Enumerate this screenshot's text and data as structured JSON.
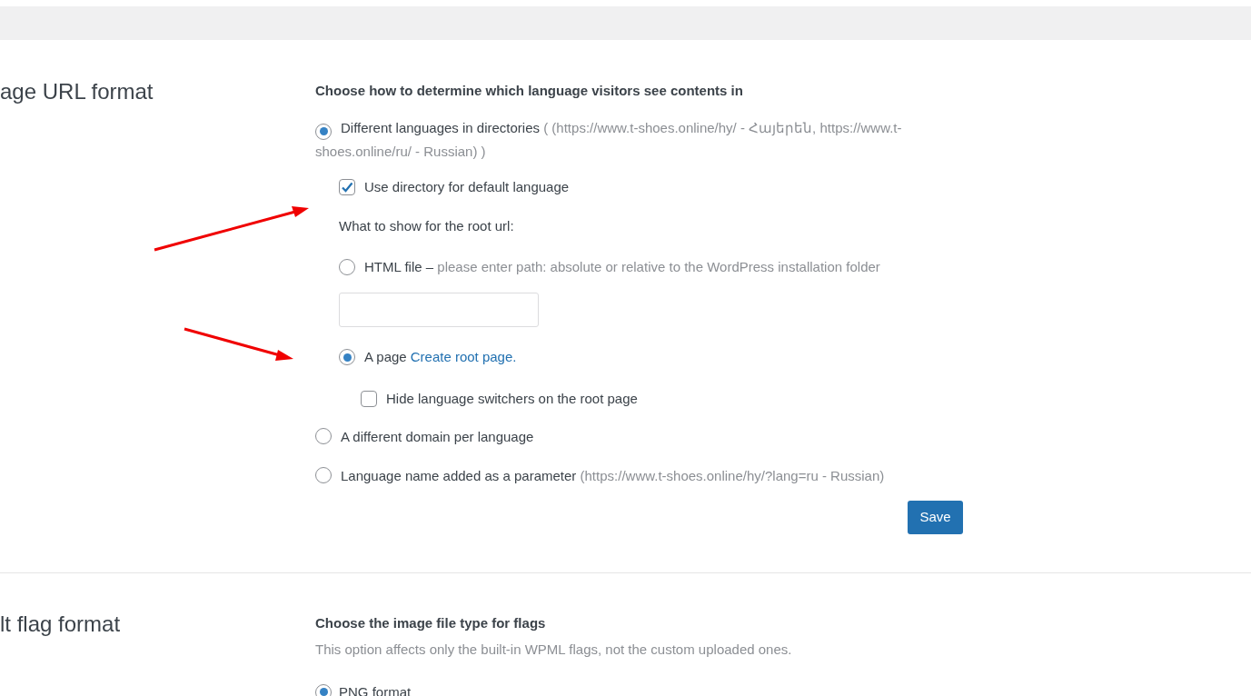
{
  "url_format": {
    "title": "age URL format",
    "heading": "Choose how to determine which language visitors see contents in",
    "options": [
      {
        "label": "Different languages in directories",
        "hint": "( (https://www.t-shoes.online/hy/ - Հայերեն, https://www.t-shoes.online/ru/ - Russian) )",
        "selected": true,
        "default_dir": {
          "label": "Use directory for default language",
          "checked": true
        },
        "root_prompt": "What to show for the root url:",
        "root_options": [
          {
            "kind": "file",
            "label": "HTML file –",
            "hint": "please enter path: absolute or relative to the WordPress installation folder",
            "selected": false
          },
          {
            "kind": "page",
            "label": "A page",
            "link": "Create root page.",
            "selected": true,
            "hide_switchers": {
              "label": "Hide language switchers on the root page",
              "checked": false
            }
          }
        ]
      },
      {
        "label": "A different domain per language",
        "selected": false
      },
      {
        "label": "Language name added as a parameter",
        "hint": "(https://www.t-shoes.online/hy/?lang=ru - Russian)",
        "selected": false
      }
    ],
    "save": "Save"
  },
  "flag_format": {
    "title": "lt flag format",
    "heading": "Choose the image file type for flags",
    "description": "This option affects only the built-in WPML flags, not the custom uploaded ones.",
    "options": [
      {
        "label": "PNG format",
        "selected": true
      }
    ]
  }
}
